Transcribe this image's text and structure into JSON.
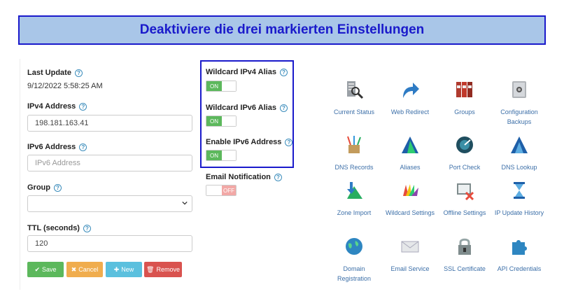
{
  "banner": {
    "text": "Deaktiviere die drei markierten Einstellungen"
  },
  "form": {
    "last_update_label": "Last Update",
    "last_update_value": "9/12/2022 5:58:25 AM",
    "ipv4_label": "IPv4 Address",
    "ipv4_value": "198.181.163.41",
    "ipv6_label": "IPv6 Address",
    "ipv6_placeholder": "IPv6 Address",
    "group_label": "Group",
    "ttl_label": "TTL (seconds)",
    "ttl_value": "120"
  },
  "buttons": {
    "save": "Save",
    "cancel": "Cancel",
    "new": "New",
    "remove": "Remove"
  },
  "toggles": [
    {
      "label": "Wildcard IPv4 Alias",
      "state": "ON"
    },
    {
      "label": "Wildcard IPv6 Alias",
      "state": "ON"
    },
    {
      "label": "Enable IPv6 Address",
      "state": "ON"
    },
    {
      "label": "Email Notification",
      "state": "OFF"
    }
  ],
  "tiles": [
    {
      "label": "Current Status",
      "icon": "server-search-icon"
    },
    {
      "label": "Web Redirect",
      "icon": "redirect-arrow-icon"
    },
    {
      "label": "Groups",
      "icon": "binders-icon"
    },
    {
      "label": "Configuration Backups",
      "icon": "safe-icon"
    },
    {
      "label": "DNS Records",
      "icon": "pencil-cup-icon"
    },
    {
      "label": "Aliases",
      "icon": "alias-triangle-icon"
    },
    {
      "label": "Port Check",
      "icon": "port-check-icon"
    },
    {
      "label": "DNS Lookup",
      "icon": "dns-lookup-icon"
    },
    {
      "label": "Zone Import",
      "icon": "zone-import-icon"
    },
    {
      "label": "Wildcard Settings",
      "icon": "color-fan-icon"
    },
    {
      "label": "Offline Settings",
      "icon": "offline-icon"
    },
    {
      "label": "IP Update History",
      "icon": "hourglass-icon"
    },
    {
      "label": "Domain Registration",
      "icon": "globe-icon"
    },
    {
      "label": "Email Service",
      "icon": "envelope-icon"
    },
    {
      "label": "SSL Certificate",
      "icon": "padlock-icon"
    },
    {
      "label": "API Credentials",
      "icon": "puzzle-icon"
    }
  ],
  "colors": {
    "banner_bg": "#a9c6e8",
    "banner_text": "#1a1acb",
    "highlight_border": "#1a1acb",
    "toggle_on": "#5cb85c",
    "toggle_off": "#f2a8a6",
    "link": "#3c6fa8"
  }
}
